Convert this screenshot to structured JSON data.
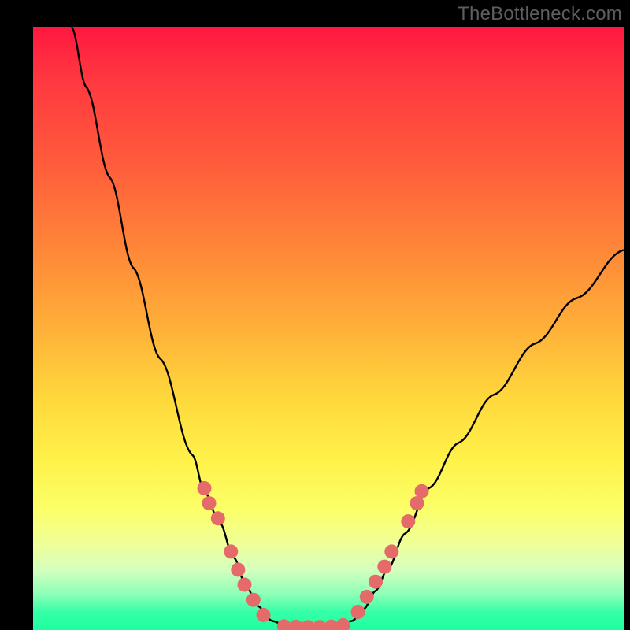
{
  "watermark": "TheBottleneck.com",
  "colors": {
    "background": "#000000",
    "watermark_text": "#5e5e5e",
    "curve_stroke": "#000000",
    "marker_fill": "#e56a6a",
    "marker_stroke": "#d25858",
    "gradient_stops": [
      "#ff1740",
      "#ff3640",
      "#ff5a3c",
      "#ff8438",
      "#ffb039",
      "#ffd93c",
      "#fff24a",
      "#fbff68",
      "#efff9a",
      "#d4ffbe",
      "#8effb8",
      "#36ffa6",
      "#1effa1"
    ]
  },
  "chart_data": {
    "type": "line",
    "title": "",
    "xlabel": "",
    "ylabel": "",
    "xlim": [
      0,
      100
    ],
    "ylim": [
      0,
      100
    ],
    "curve": [
      {
        "x": 6.5,
        "y": 100.0
      },
      {
        "x": 9.0,
        "y": 90.0
      },
      {
        "x": 13.0,
        "y": 75.0
      },
      {
        "x": 17.0,
        "y": 60.0
      },
      {
        "x": 21.5,
        "y": 45.0
      },
      {
        "x": 27.0,
        "y": 29.0
      },
      {
        "x": 29.0,
        "y": 23.0
      },
      {
        "x": 31.5,
        "y": 18.0
      },
      {
        "x": 34.0,
        "y": 12.0
      },
      {
        "x": 36.0,
        "y": 7.5
      },
      {
        "x": 38.0,
        "y": 4.0
      },
      {
        "x": 40.5,
        "y": 1.5
      },
      {
        "x": 43.0,
        "y": 0.6
      },
      {
        "x": 47.0,
        "y": 0.5
      },
      {
        "x": 51.0,
        "y": 0.6
      },
      {
        "x": 54.0,
        "y": 1.5
      },
      {
        "x": 56.0,
        "y": 3.5
      },
      {
        "x": 58.0,
        "y": 6.5
      },
      {
        "x": 60.0,
        "y": 10.0
      },
      {
        "x": 63.0,
        "y": 16.0
      },
      {
        "x": 67.0,
        "y": 23.5
      },
      {
        "x": 72.0,
        "y": 31.0
      },
      {
        "x": 78.0,
        "y": 39.0
      },
      {
        "x": 85.0,
        "y": 47.5
      },
      {
        "x": 92.0,
        "y": 55.0
      },
      {
        "x": 100.0,
        "y": 63.0
      }
    ],
    "markers": [
      {
        "x": 29.0,
        "y": 23.5
      },
      {
        "x": 29.8,
        "y": 21.0
      },
      {
        "x": 31.3,
        "y": 18.5
      },
      {
        "x": 33.5,
        "y": 13.0
      },
      {
        "x": 34.7,
        "y": 10.0
      },
      {
        "x": 35.8,
        "y": 7.5
      },
      {
        "x": 37.3,
        "y": 5.0
      },
      {
        "x": 39.0,
        "y": 2.5
      },
      {
        "x": 42.5,
        "y": 0.6
      },
      {
        "x": 44.5,
        "y": 0.55
      },
      {
        "x": 46.5,
        "y": 0.5
      },
      {
        "x": 48.5,
        "y": 0.5
      },
      {
        "x": 50.5,
        "y": 0.55
      },
      {
        "x": 52.5,
        "y": 0.8
      },
      {
        "x": 55.0,
        "y": 3.0
      },
      {
        "x": 56.5,
        "y": 5.5
      },
      {
        "x": 58.0,
        "y": 8.0
      },
      {
        "x": 59.5,
        "y": 10.5
      },
      {
        "x": 60.7,
        "y": 13.0
      },
      {
        "x": 63.5,
        "y": 18.0
      },
      {
        "x": 65.0,
        "y": 21.0
      },
      {
        "x": 65.8,
        "y": 23.0
      }
    ]
  }
}
